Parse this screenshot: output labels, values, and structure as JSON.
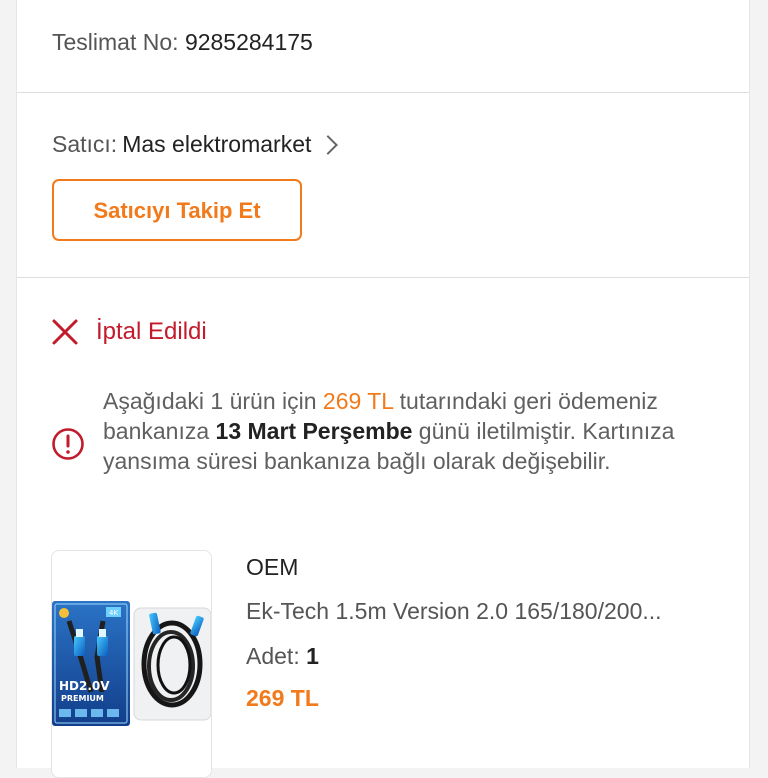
{
  "delivery": {
    "label": "Teslimat No:",
    "number": "9285284175"
  },
  "seller": {
    "label": "Satıcı:",
    "name": "Mas elektromarket",
    "follow_button": "Satıcıyı Takip Et"
  },
  "status": {
    "text": "İptal Edildi",
    "icon": "close-icon",
    "color": "#c11b2c"
  },
  "refund": {
    "part1": "Aşağıdaki 1 ürün için ",
    "amount": "269 TL",
    "part2": " tutarındaki geri ödemeniz bankanıza ",
    "date": "13 Mart Perşembe",
    "part3": " günü iletilmiştir. Kartınıza yansıma süresi bankanıza bağlı olarak değişebilir.",
    "icon": "info-circle-icon"
  },
  "product": {
    "brand": "OEM",
    "name": "Ek-Tech 1.5m Version 2.0 165/180/200...",
    "quantity_label": "Adet:",
    "quantity": "1",
    "price": "269 TL",
    "image": {
      "icon": "hdmi-cable-product-image",
      "box_text_1": "HD2.0V",
      "box_text_2": "PREMIUM",
      "badge": "4K"
    }
  },
  "colors": {
    "accent": "#f27a1a",
    "cancel_red": "#c11b2c",
    "divider": "#dedede",
    "page_background": "#f3f3f3"
  }
}
